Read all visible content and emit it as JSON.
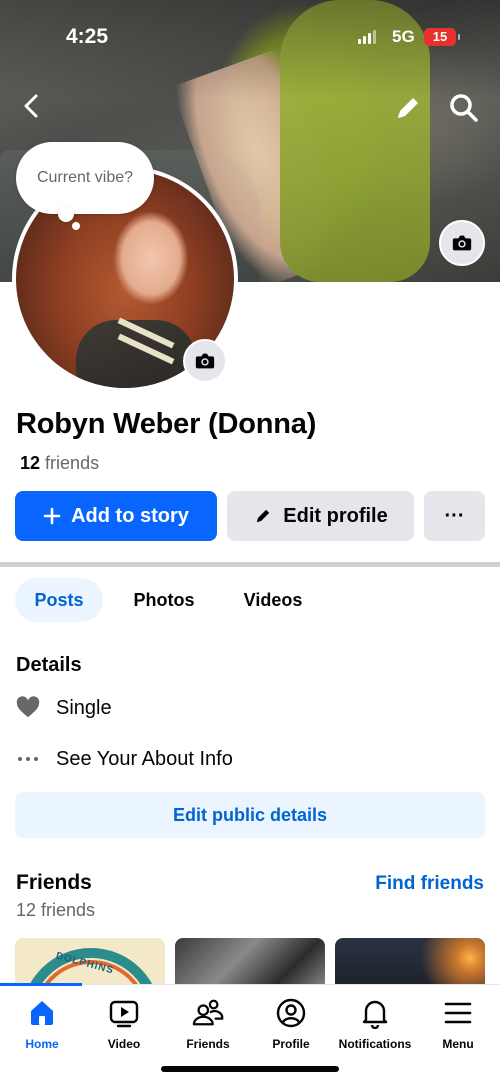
{
  "status_bar": {
    "time": "4:25",
    "network": "5G",
    "battery": "15"
  },
  "cover": {
    "vibe_prompt": "Current vibe?"
  },
  "profile": {
    "name": "Robyn Weber (Donna)",
    "friends_count": "12",
    "friends_label": "friends"
  },
  "actions": {
    "add_to_story": "Add to story",
    "edit_profile": "Edit profile",
    "more": "···"
  },
  "tabs": [
    "Posts",
    "Photos",
    "Videos"
  ],
  "details": {
    "title": "Details",
    "relationship": "Single",
    "see_about": "See Your About Info",
    "edit_public": "Edit public details"
  },
  "friends_section": {
    "title": "Friends",
    "find_friends": "Find friends",
    "subtitle": "12 friends",
    "thumb1_text": "DOLPHINS"
  },
  "bottom_nav": [
    {
      "label": "Home",
      "icon": "home-icon",
      "active": true
    },
    {
      "label": "Video",
      "icon": "video-icon",
      "active": false
    },
    {
      "label": "Friends",
      "icon": "friends-icon",
      "active": false
    },
    {
      "label": "Profile",
      "icon": "profile-icon",
      "active": false
    },
    {
      "label": "Notifications",
      "icon": "bell-icon",
      "active": false
    },
    {
      "label": "Menu",
      "icon": "menu-icon",
      "active": false
    }
  ],
  "colors": {
    "accent": "#0866ff",
    "link": "#0064d1",
    "secondary_text": "#65676b",
    "button_gray": "#e4e6eb",
    "tab_active_bg": "#ebf5ff"
  }
}
